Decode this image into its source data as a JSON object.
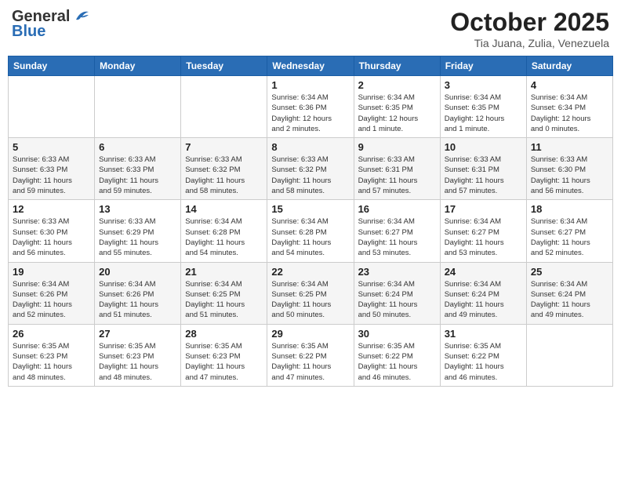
{
  "header": {
    "logo_general": "General",
    "logo_blue": "Blue",
    "month_title": "October 2025",
    "subtitle": "Tia Juana, Zulia, Venezuela"
  },
  "days_of_week": [
    "Sunday",
    "Monday",
    "Tuesday",
    "Wednesday",
    "Thursday",
    "Friday",
    "Saturday"
  ],
  "weeks": [
    [
      {
        "day": "",
        "info": ""
      },
      {
        "day": "",
        "info": ""
      },
      {
        "day": "",
        "info": ""
      },
      {
        "day": "1",
        "info": "Sunrise: 6:34 AM\nSunset: 6:36 PM\nDaylight: 12 hours\nand 2 minutes."
      },
      {
        "day": "2",
        "info": "Sunrise: 6:34 AM\nSunset: 6:35 PM\nDaylight: 12 hours\nand 1 minute."
      },
      {
        "day": "3",
        "info": "Sunrise: 6:34 AM\nSunset: 6:35 PM\nDaylight: 12 hours\nand 1 minute."
      },
      {
        "day": "4",
        "info": "Sunrise: 6:34 AM\nSunset: 6:34 PM\nDaylight: 12 hours\nand 0 minutes."
      }
    ],
    [
      {
        "day": "5",
        "info": "Sunrise: 6:33 AM\nSunset: 6:33 PM\nDaylight: 11 hours\nand 59 minutes."
      },
      {
        "day": "6",
        "info": "Sunrise: 6:33 AM\nSunset: 6:33 PM\nDaylight: 11 hours\nand 59 minutes."
      },
      {
        "day": "7",
        "info": "Sunrise: 6:33 AM\nSunset: 6:32 PM\nDaylight: 11 hours\nand 58 minutes."
      },
      {
        "day": "8",
        "info": "Sunrise: 6:33 AM\nSunset: 6:32 PM\nDaylight: 11 hours\nand 58 minutes."
      },
      {
        "day": "9",
        "info": "Sunrise: 6:33 AM\nSunset: 6:31 PM\nDaylight: 11 hours\nand 57 minutes."
      },
      {
        "day": "10",
        "info": "Sunrise: 6:33 AM\nSunset: 6:31 PM\nDaylight: 11 hours\nand 57 minutes."
      },
      {
        "day": "11",
        "info": "Sunrise: 6:33 AM\nSunset: 6:30 PM\nDaylight: 11 hours\nand 56 minutes."
      }
    ],
    [
      {
        "day": "12",
        "info": "Sunrise: 6:33 AM\nSunset: 6:30 PM\nDaylight: 11 hours\nand 56 minutes."
      },
      {
        "day": "13",
        "info": "Sunrise: 6:33 AM\nSunset: 6:29 PM\nDaylight: 11 hours\nand 55 minutes."
      },
      {
        "day": "14",
        "info": "Sunrise: 6:34 AM\nSunset: 6:28 PM\nDaylight: 11 hours\nand 54 minutes."
      },
      {
        "day": "15",
        "info": "Sunrise: 6:34 AM\nSunset: 6:28 PM\nDaylight: 11 hours\nand 54 minutes."
      },
      {
        "day": "16",
        "info": "Sunrise: 6:34 AM\nSunset: 6:27 PM\nDaylight: 11 hours\nand 53 minutes."
      },
      {
        "day": "17",
        "info": "Sunrise: 6:34 AM\nSunset: 6:27 PM\nDaylight: 11 hours\nand 53 minutes."
      },
      {
        "day": "18",
        "info": "Sunrise: 6:34 AM\nSunset: 6:27 PM\nDaylight: 11 hours\nand 52 minutes."
      }
    ],
    [
      {
        "day": "19",
        "info": "Sunrise: 6:34 AM\nSunset: 6:26 PM\nDaylight: 11 hours\nand 52 minutes."
      },
      {
        "day": "20",
        "info": "Sunrise: 6:34 AM\nSunset: 6:26 PM\nDaylight: 11 hours\nand 51 minutes."
      },
      {
        "day": "21",
        "info": "Sunrise: 6:34 AM\nSunset: 6:25 PM\nDaylight: 11 hours\nand 51 minutes."
      },
      {
        "day": "22",
        "info": "Sunrise: 6:34 AM\nSunset: 6:25 PM\nDaylight: 11 hours\nand 50 minutes."
      },
      {
        "day": "23",
        "info": "Sunrise: 6:34 AM\nSunset: 6:24 PM\nDaylight: 11 hours\nand 50 minutes."
      },
      {
        "day": "24",
        "info": "Sunrise: 6:34 AM\nSunset: 6:24 PM\nDaylight: 11 hours\nand 49 minutes."
      },
      {
        "day": "25",
        "info": "Sunrise: 6:34 AM\nSunset: 6:24 PM\nDaylight: 11 hours\nand 49 minutes."
      }
    ],
    [
      {
        "day": "26",
        "info": "Sunrise: 6:35 AM\nSunset: 6:23 PM\nDaylight: 11 hours\nand 48 minutes."
      },
      {
        "day": "27",
        "info": "Sunrise: 6:35 AM\nSunset: 6:23 PM\nDaylight: 11 hours\nand 48 minutes."
      },
      {
        "day": "28",
        "info": "Sunrise: 6:35 AM\nSunset: 6:23 PM\nDaylight: 11 hours\nand 47 minutes."
      },
      {
        "day": "29",
        "info": "Sunrise: 6:35 AM\nSunset: 6:22 PM\nDaylight: 11 hours\nand 47 minutes."
      },
      {
        "day": "30",
        "info": "Sunrise: 6:35 AM\nSunset: 6:22 PM\nDaylight: 11 hours\nand 46 minutes."
      },
      {
        "day": "31",
        "info": "Sunrise: 6:35 AM\nSunset: 6:22 PM\nDaylight: 11 hours\nand 46 minutes."
      },
      {
        "day": "",
        "info": ""
      }
    ]
  ]
}
